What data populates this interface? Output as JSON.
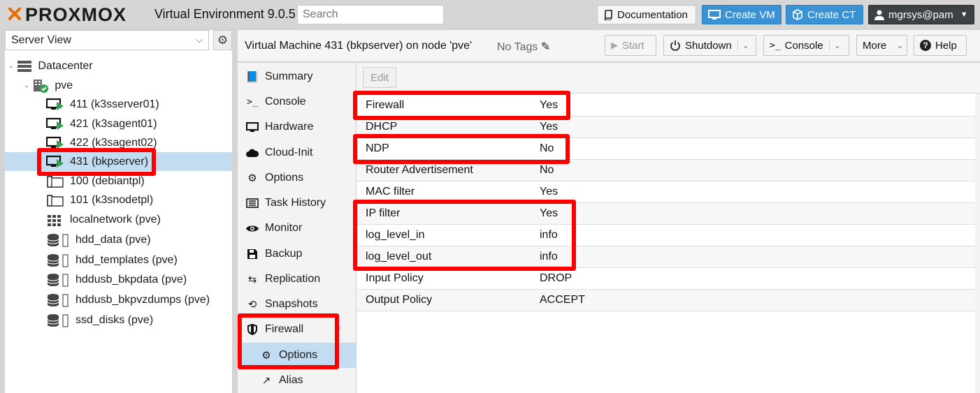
{
  "app": {
    "logo": "PROXMOX",
    "version": "Virtual Environment 9.0.5",
    "search_placeholder": "Search"
  },
  "top_buttons": {
    "documentation": "Documentation",
    "create_vm": "Create VM",
    "create_ct": "Create CT",
    "user": "mgrsys@pam"
  },
  "left": {
    "view_select": "Server View",
    "tree": [
      {
        "label": "Datacenter",
        "type": "datacenter"
      },
      {
        "label": "pve",
        "type": "node"
      },
      {
        "label": "411 (k3sserver01)",
        "type": "vm-running"
      },
      {
        "label": "421 (k3sagent01)",
        "type": "vm-running"
      },
      {
        "label": "422 (k3sagent02)",
        "type": "vm-running"
      },
      {
        "label": "431 (bkpserver)",
        "type": "vm-running",
        "selected": true
      },
      {
        "label": "100 (debiantpl)",
        "type": "template"
      },
      {
        "label": "101 (k3snodetpl)",
        "type": "template"
      },
      {
        "label": "localnetwork (pve)",
        "type": "network"
      },
      {
        "label": "hdd_data (pve)",
        "type": "storage"
      },
      {
        "label": "hdd_templates (pve)",
        "type": "storage"
      },
      {
        "label": "hddusb_bkpdata (pve)",
        "type": "storage"
      },
      {
        "label": "hddusb_bkpvzdumps (pve)",
        "type": "storage"
      },
      {
        "label": "ssd_disks (pve)",
        "type": "storage"
      }
    ]
  },
  "header": {
    "title": "Virtual Machine 431 (bkpserver) on node 'pve'",
    "tags": "No Tags",
    "start": "Start",
    "shutdown": "Shutdown",
    "console": "Console",
    "more": "More",
    "help": "Help"
  },
  "menu": [
    {
      "label": "Summary",
      "icon": "book-icon"
    },
    {
      "label": "Console",
      "icon": "terminal-icon"
    },
    {
      "label": "Hardware",
      "icon": "monitor-icon"
    },
    {
      "label": "Cloud-Init",
      "icon": "cloud-icon"
    },
    {
      "label": "Options",
      "icon": "gear-icon"
    },
    {
      "label": "Task History",
      "icon": "list-icon"
    },
    {
      "label": "Monitor",
      "icon": "eye-icon"
    },
    {
      "label": "Backup",
      "icon": "floppy-icon"
    },
    {
      "label": "Replication",
      "icon": "retweet-icon"
    },
    {
      "label": "Snapshots",
      "icon": "history-icon"
    },
    {
      "label": "Firewall",
      "icon": "shield-icon"
    },
    {
      "label": "Options",
      "icon": "gear-icon",
      "sub": true,
      "selected": true
    },
    {
      "label": "Alias",
      "icon": "external-link-icon",
      "sub": true
    }
  ],
  "content": {
    "edit": "Edit",
    "rows": [
      {
        "key": "Firewall",
        "value": "Yes"
      },
      {
        "key": "DHCP",
        "value": "Yes"
      },
      {
        "key": "NDP",
        "value": "No"
      },
      {
        "key": "Router Advertisement",
        "value": "No"
      },
      {
        "key": "MAC filter",
        "value": "Yes"
      },
      {
        "key": "IP filter",
        "value": "Yes"
      },
      {
        "key": "log_level_in",
        "value": "info"
      },
      {
        "key": "log_level_out",
        "value": "info"
      },
      {
        "key": "Input Policy",
        "value": "DROP"
      },
      {
        "key": "Output Policy",
        "value": "ACCEPT"
      }
    ]
  },
  "colors": {
    "accent": "#3892d4",
    "highlight": "#ff0000",
    "selection": "#c2ddf2",
    "brand": "#e57000"
  }
}
